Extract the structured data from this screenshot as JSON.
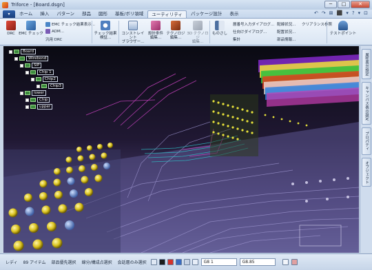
{
  "window": {
    "title": "Triforce - [Board.dsgn]",
    "min": "─",
    "max": "□",
    "close": "✕"
  },
  "tabs": {
    "app_button": "▾",
    "items": [
      "ホーム",
      "挿入",
      "パターン",
      "部品",
      "図形",
      "基板/ボリ領域",
      "ユーティリティ",
      "パッケージ設計",
      "表示"
    ],
    "active_index": 6
  },
  "qat": [
    "↶",
    "↷",
    "⊠",
    "⬛",
    "▾",
    "?",
    "▾",
    "⊡"
  ],
  "ribbon": {
    "drc": "DRC",
    "emc_check": "EMC チェック",
    "emc_result": "EMC チェック結果表示...",
    "adm": "ADM...",
    "general_drc": "汎用 DRC",
    "check_result": "チェック結果\n検証...",
    "constraint_browser": "コンストレイント\nブラウザー...",
    "design_rules": "設計条件\n編集...",
    "technology": "テクノロジ\n編集...",
    "tech_3d": "3D テクノロジ\n編集...",
    "monoshi": "ものさし",
    "layer_dialog": "層番号入力ダイアログ...",
    "exit_dialog": "仕向けダイアログ...",
    "aggregate": "集計",
    "wiring_status": "配線状況...",
    "clearance_ref": "クリアランス参照",
    "placement_status": "配置状況...",
    "part_info": "部品情報...",
    "test_point": "テストポイント"
  },
  "tree": {
    "board": "Board",
    "wirebond": "Wirebond",
    "sip": "SIP",
    "chip1": "Chip 1",
    "chip2": "Chip2",
    "chip3": "Chip3",
    "lower": "lower",
    "chip": "Chip",
    "upper": "upper"
  },
  "dock_tabs": [
    "属性表示設定",
    "キャンバス表示設定",
    "プロパティ",
    "オブジェクト"
  ],
  "status": {
    "ready": "レディ",
    "count": "89 アイテム",
    "part_priority": "部品優先選択",
    "segment_select": "線分/構成点選択",
    "layer_only": "会話層のみ選択",
    "combo1": "G8 1",
    "combo2": "G8.85"
  },
  "colors": {
    "accent": "#2d5ea8",
    "ribbon_bg": "#dbe7f5"
  }
}
